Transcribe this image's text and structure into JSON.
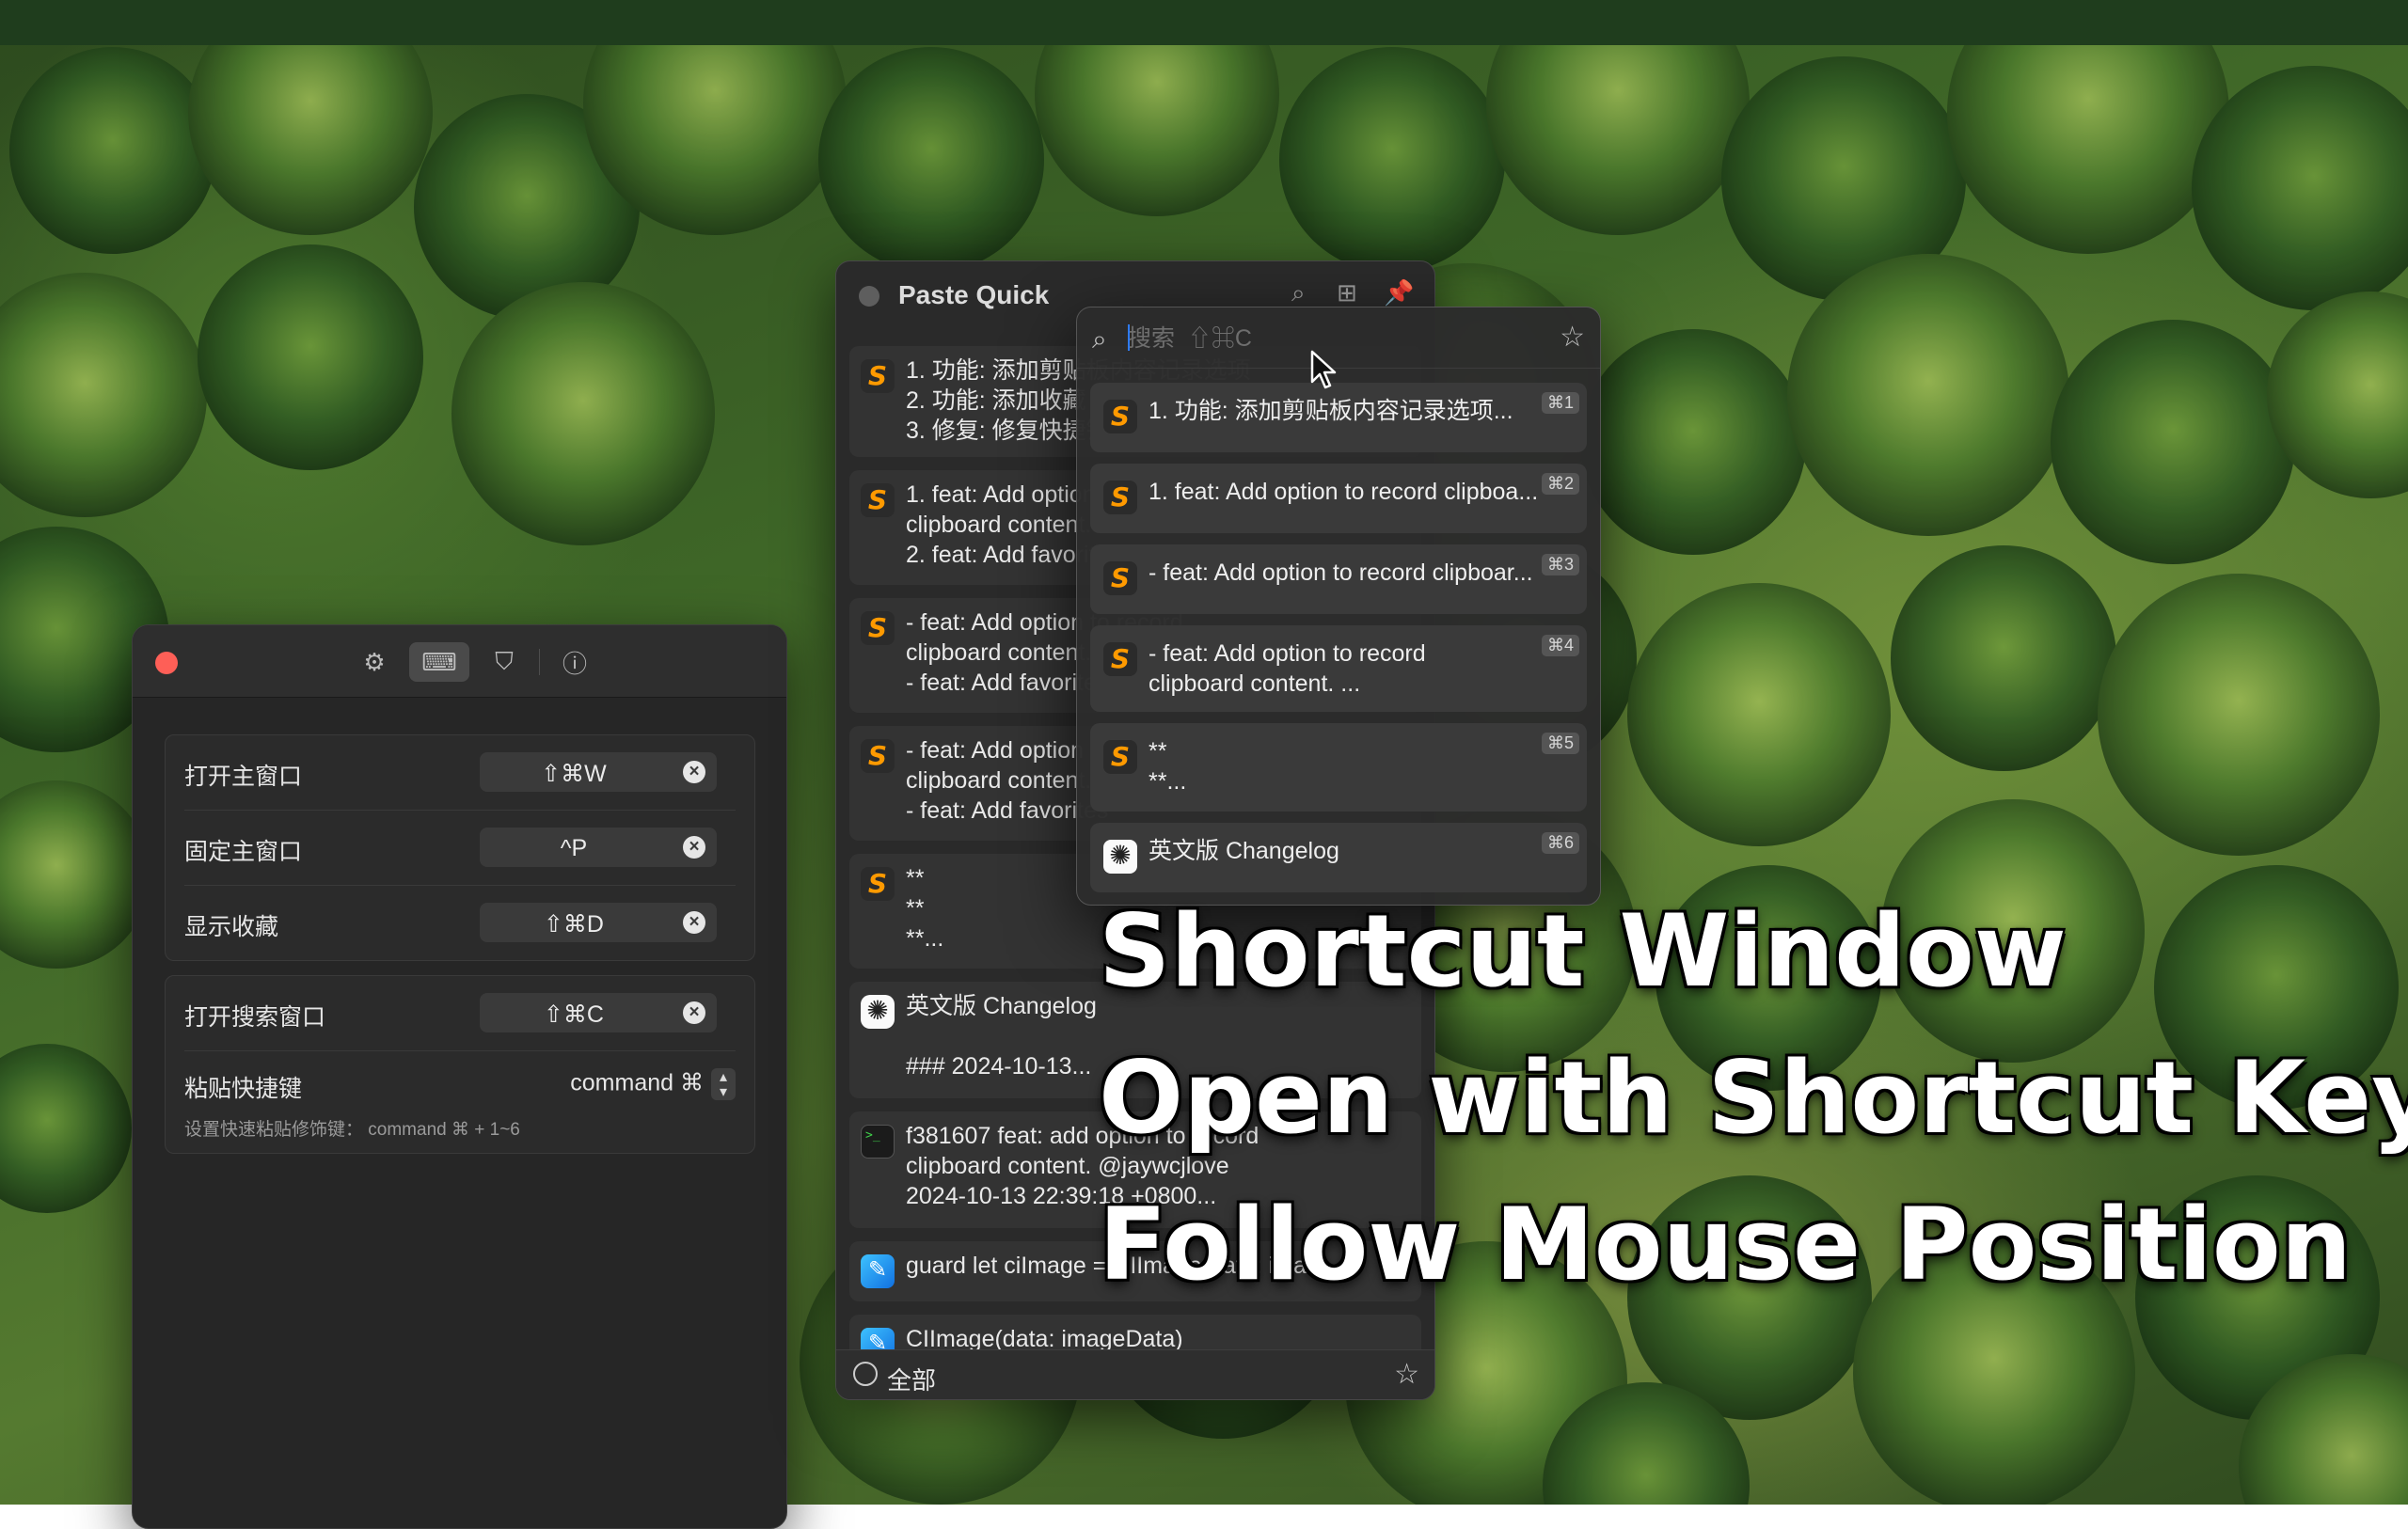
{
  "settings": {
    "tabs": [
      {
        "icon": "gear-icon"
      },
      {
        "icon": "keyboard-icon"
      },
      {
        "icon": "shield-icon"
      },
      {
        "icon": "info-icon"
      }
    ],
    "shortcuts": [
      {
        "label": "打开主窗口",
        "keys": "⇧⌘W"
      },
      {
        "label": "固定主窗口",
        "keys": "^P"
      },
      {
        "label": "显示收藏",
        "keys": "⇧⌘D"
      }
    ],
    "search_shortcut": {
      "label": "打开搜索窗口",
      "keys": "⇧⌘C"
    },
    "paste_modifier": {
      "label": "粘贴快捷键",
      "value": "command ⌘",
      "hint": "设置快速粘贴修饰键： command ⌘ + 1~6"
    }
  },
  "main_window": {
    "title": "Paste Quick",
    "items": [
      {
        "icon": "sublime-icon",
        "text": "1. 功能: 添加剪贴板内容记录选项\n2. 功能: 添加收藏\n3. 修复: 修复快捷键"
      },
      {
        "icon": "sublime-icon",
        "text": "1. feat: Add option to record\nclipboard content.\n2. feat: Add favorites"
      },
      {
        "icon": "sublime-icon",
        "text": "- feat: Add option to record\nclipboard content.\n- feat: Add favorites"
      },
      {
        "icon": "sublime-icon",
        "text": "- feat: Add option to record\nclipboard content.\n- feat: Add favorites"
      },
      {
        "icon": "sublime-icon",
        "text": "**\n**\n**..."
      },
      {
        "icon": "chatgpt-icon",
        "text": "英文版 Changelog\n\n### 2024-10-13..."
      },
      {
        "icon": "terminal-icon",
        "text": "f381607 feat: add option to record\nclipboard content. @jaywcjlove\n2024-10-13 22:39:18 +0800..."
      },
      {
        "icon": "xcode-icon",
        "text": "guard let ciImage = CIImage(data: ima"
      },
      {
        "icon": "xcode-icon",
        "text": "CIImage(data: imageData)"
      }
    ],
    "footer": {
      "filter_label": "全部"
    }
  },
  "popup": {
    "search_placeholder": "搜索  ⇧⌘C",
    "items": [
      {
        "icon": "sublime-icon",
        "text": "1. 功能: 添加剪贴板内容记录选项...",
        "shortcut": "⌘1"
      },
      {
        "icon": "sublime-icon",
        "text": "1. feat: Add option to record clipboa...",
        "shortcut": "⌘2"
      },
      {
        "icon": "sublime-icon",
        "text": "- feat: Add option to record clipboar...",
        "shortcut": "⌘3"
      },
      {
        "icon": "sublime-icon",
        "text": "- feat: Add option to record\nclipboard content. ...",
        "shortcut": "⌘4"
      },
      {
        "icon": "sublime-icon",
        "text": "**\n**...",
        "shortcut": "⌘5"
      },
      {
        "icon": "chatgpt-icon",
        "text": "英文版 Changelog",
        "shortcut": "⌘6"
      }
    ]
  },
  "captions": [
    "Shortcut Window",
    "Open with Shortcut Key",
    "Follow Mouse Position"
  ]
}
